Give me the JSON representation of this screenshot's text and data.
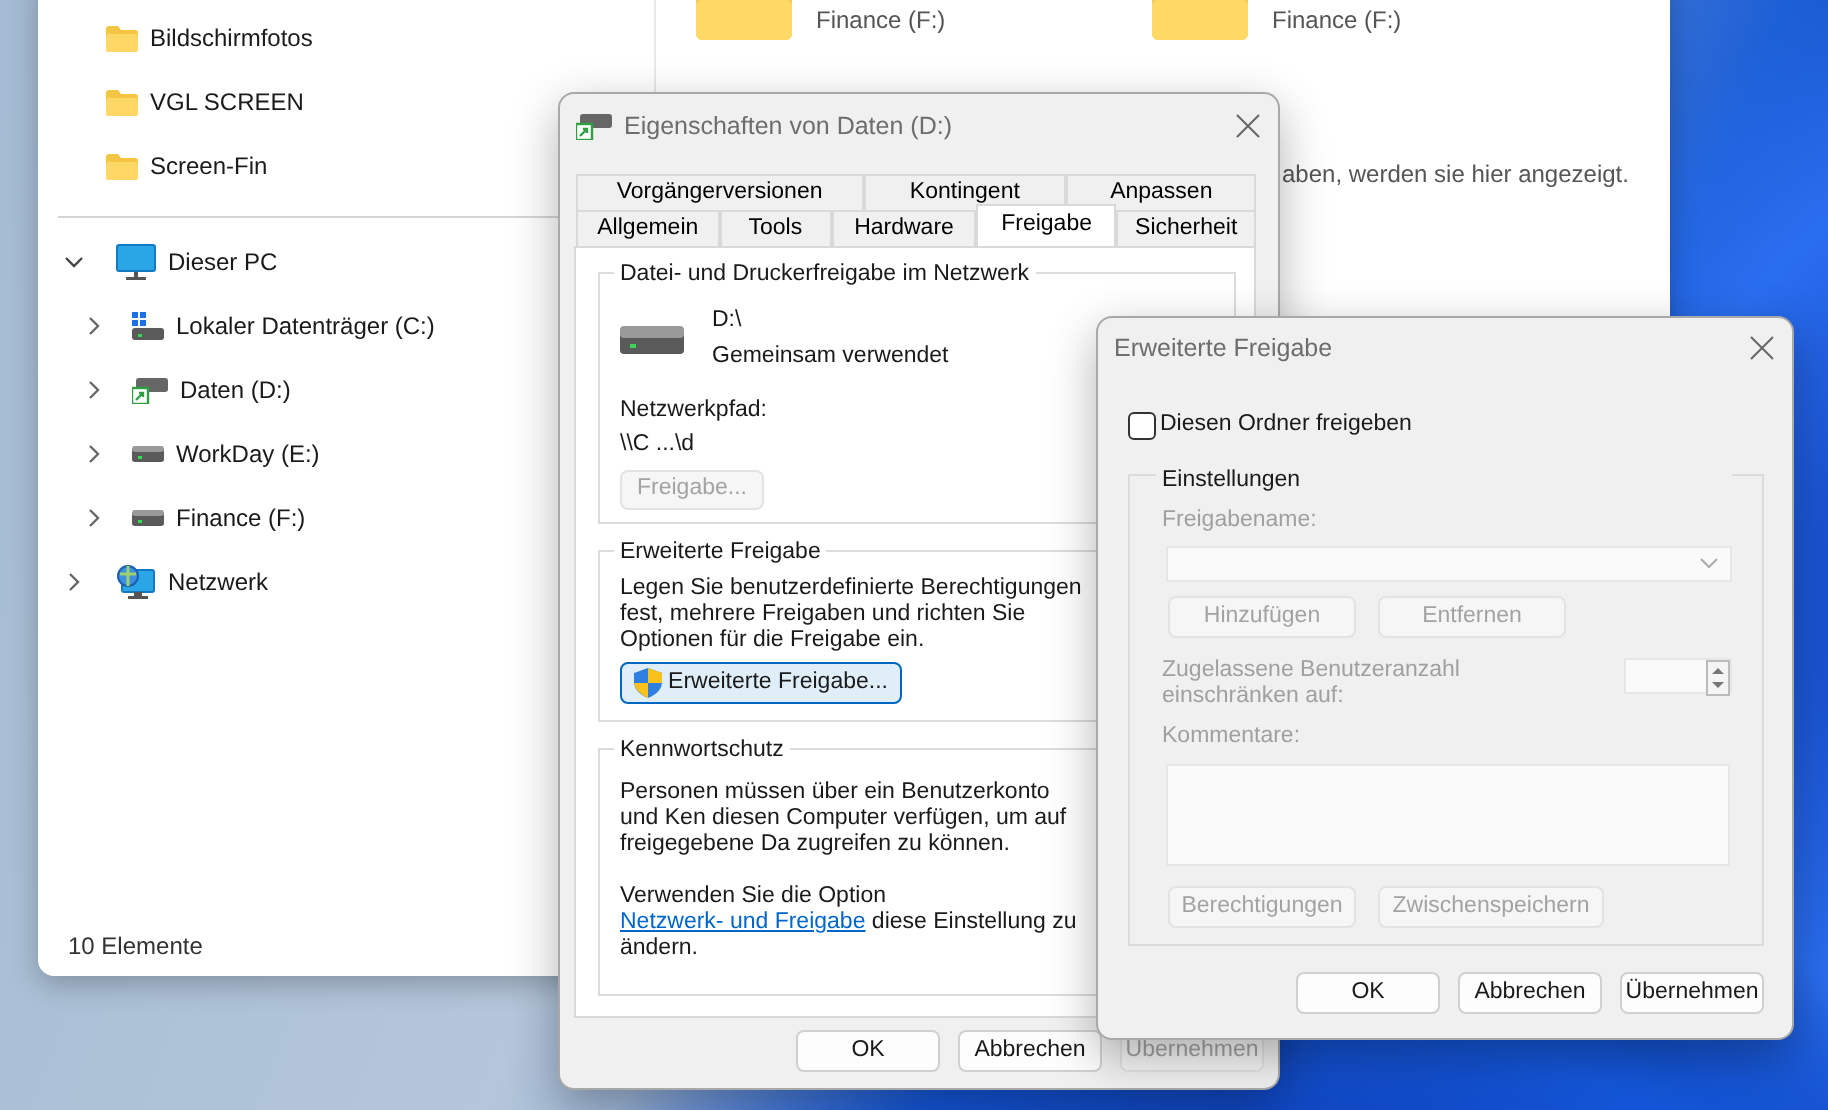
{
  "explorer": {
    "nav_items": [
      {
        "label": "Bildschirmfotos",
        "kind": "folder"
      },
      {
        "label": "VGL SCREEN",
        "kind": "folder"
      },
      {
        "label": "Screen-Fin",
        "kind": "folder"
      }
    ],
    "tree": [
      {
        "label": "Dieser PC",
        "kind": "pc",
        "expanded": true,
        "children": [
          {
            "label": "Lokaler Datenträger (C:)",
            "kind": "system-drive",
            "expanded": false
          },
          {
            "label": "Daten (D:)",
            "kind": "shared-drive",
            "expanded": false
          },
          {
            "label": "WorkDay (E:)",
            "kind": "drive",
            "expanded": false
          },
          {
            "label": "Finance (F:)",
            "kind": "drive",
            "expanded": false
          }
        ]
      },
      {
        "label": "Netzwerk",
        "kind": "network",
        "expanded": false
      }
    ],
    "items": [
      {
        "label": "Finance (F:)"
      },
      {
        "label": "Finance (F:)"
      }
    ],
    "empty_message": "aben, werden sie hier angezeigt.",
    "status_bar": "10 Elemente"
  },
  "properties_dialog": {
    "title": "Eigenschaften von Daten (D:)",
    "tab_rows": [
      {
        "tabs": [
          {
            "label": "Vorgängerversionen",
            "selected": false
          },
          {
            "label": "Kontingent",
            "selected": false
          },
          {
            "label": "Anpassen",
            "selected": false
          }
        ]
      },
      {
        "tabs": [
          {
            "label": "Allgemein",
            "selected": false
          },
          {
            "label": "Tools",
            "selected": false
          },
          {
            "label": "Hardware",
            "selected": false
          },
          {
            "label": "Freigabe",
            "selected": true
          },
          {
            "label": "Sicherheit",
            "selected": false
          }
        ]
      }
    ],
    "network_sharing": {
      "heading": "Datei- und Druckerfreigabe im Netzwerk",
      "drive": "D:\\",
      "state": "Gemeinsam verwendet",
      "path_label": "Netzwerkpfad:",
      "path": "\\\\C ...\\d",
      "button": {
        "label": "Freigabe...",
        "disabled": true
      }
    },
    "advanced_sharing": {
      "heading": "Erweiterte Freigabe",
      "text": "Legen Sie benutzerdefinierte Berechtigungen fest, mehrere Freigaben und richten Sie Optionen für die Freigabe ein.",
      "button": {
        "label": "Erweiterte Freigabe...",
        "focused": true
      }
    },
    "password_protection": {
      "heading": "Kennwortschutz",
      "text": "Personen müssen über ein Benutzerkonto und Ken diesen Computer verfügen, um auf freigegebene Da zugreifen zu können.",
      "option_before": "Verwenden Sie die Option",
      "option_link": "Netzwerk- und Freigabe",
      "option_after": "diese Einstellung zu ändern."
    },
    "buttons": [
      {
        "label": "OK",
        "disabled": false
      },
      {
        "label": "Abbrechen",
        "disabled": false
      },
      {
        "label": "Übernehmen",
        "disabled": true
      }
    ]
  },
  "advanced_dialog": {
    "title": "Erweiterte Freigabe",
    "share_checkbox": {
      "label": "Diesen Ordner freigeben",
      "checked": false
    },
    "settings": {
      "heading": "Einstellungen",
      "disabled": true,
      "share_name_label": "Freigabename:",
      "name_buttons": [
        "Hinzufügen",
        "Entfernen"
      ],
      "user_limit_label": "Zugelassene Benutzeranzahl einschränken auf:",
      "comments_label": "Kommentare:",
      "lower_buttons": [
        "Berechtigungen",
        "Zwischenspeichern"
      ]
    },
    "buttons": [
      {
        "label": "OK",
        "disabled": false
      },
      {
        "label": "Abbrechen",
        "disabled": false
      },
      {
        "label": "Übernehmen",
        "disabled": false
      }
    ]
  }
}
